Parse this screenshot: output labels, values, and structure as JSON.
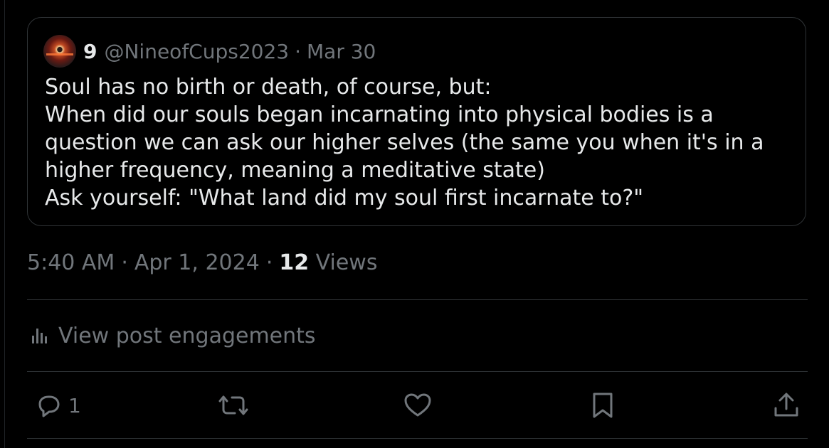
{
  "quote": {
    "display_name": "9",
    "handle": "@NineofCups2023",
    "separator": "·",
    "date": "Mar 30",
    "lines": [
      "Soul has no birth or death, of course, but:",
      "When did our souls began incarnating into physical bodies is a",
      "question we can ask our higher selves (the same you when it's in a",
      "higher frequency, meaning a meditative state)",
      "Ask yourself: \"What land did my soul first incarnate to?\""
    ]
  },
  "meta": {
    "time": "5:40 AM",
    "dot1": "·",
    "date": "Apr 1, 2024",
    "dot2": "·",
    "views_count": "12",
    "views_label": "Views"
  },
  "engagements": {
    "label": "View post engagements",
    "icon": "bar-chart-icon"
  },
  "actions": {
    "reply_count": "1",
    "icons": [
      "reply-icon",
      "repost-icon",
      "like-icon",
      "bookmark-icon",
      "share-icon"
    ]
  },
  "colors": {
    "background": "#000000",
    "primary_text": "#e7e9ea",
    "secondary_text": "#71767b",
    "border": "#2f3336"
  }
}
